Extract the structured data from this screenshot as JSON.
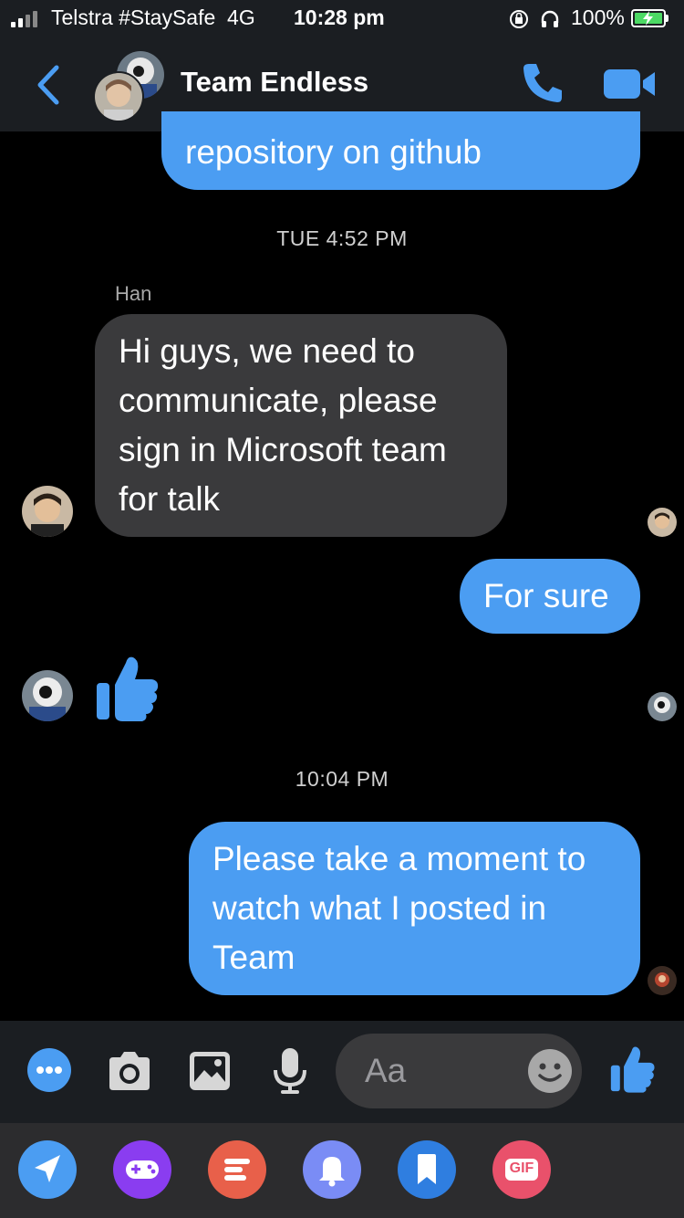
{
  "status_bar": {
    "carrier": "Telstra #StaySafe",
    "network": "4G",
    "time": "10:28 pm",
    "battery": "100%"
  },
  "header": {
    "title": "Team Endless",
    "back_icon": "chevron-left-icon",
    "call_icon": "phone-icon",
    "video_icon": "video-camera-icon"
  },
  "messages": {
    "m1": "repository on github",
    "ts1": "TUE 4:52 PM",
    "han_name": "Han",
    "m2_line1": "Hi guys, we need to",
    "m2_line2": "communicate, please",
    "m2_line3": "sign in Microsoft team",
    "m2_line4": "for talk",
    "m3": "For sure",
    "reaction_icon": "thumbs-up-icon",
    "ts2": "10:04 PM",
    "m4_line1": "Please take a moment to",
    "m4_line2": "watch what I posted in",
    "m4_line3": "Team"
  },
  "composer": {
    "placeholder": "Aa",
    "icons": [
      "more-icon",
      "camera-icon",
      "gallery-icon",
      "microphone-icon",
      "emoji-icon",
      "thumbs-up-icon"
    ]
  },
  "extensions": {
    "gif_label": "GIF",
    "icons": [
      "location-icon",
      "game-icon",
      "text-icon",
      "bell-icon",
      "bookmark-icon",
      "gif-icon"
    ]
  },
  "colors": {
    "accent": "#4b9df2",
    "incoming_bubble": "#3a3a3c",
    "bar_bg": "#1b1e22"
  }
}
